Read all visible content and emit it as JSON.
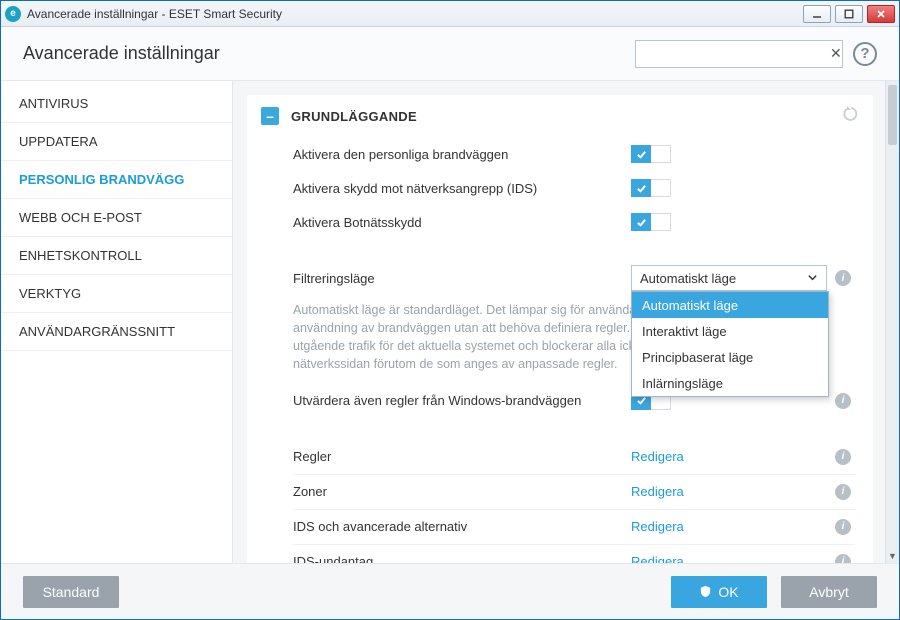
{
  "titlebar": {
    "app_icon_letter": "e",
    "title": "Avancerade inställningar - ESET Smart Security"
  },
  "header": {
    "title": "Avancerade inställningar",
    "search_placeholder": "",
    "search_value": "",
    "clear_glyph": "✕",
    "help_glyph": "?"
  },
  "sidebar": {
    "items": [
      {
        "label": "ANTIVIRUS",
        "active": false
      },
      {
        "label": "UPPDATERA",
        "active": false
      },
      {
        "label": "PERSONLIG BRANDVÄGG",
        "active": true
      },
      {
        "label": "WEBB OCH E-POST",
        "active": false
      },
      {
        "label": "ENHETSKONTROLL",
        "active": false
      },
      {
        "label": "VERKTYG",
        "active": false
      },
      {
        "label": "ANVÄNDARGRÄNSSNITT",
        "active": false
      }
    ]
  },
  "panel": {
    "collapse_glyph": "–",
    "title": "GRUNDLÄGGANDE",
    "toggles": [
      {
        "label": "Aktivera den personliga brandväggen",
        "on": true
      },
      {
        "label": "Aktivera skydd mot nätverksangrepp (IDS)",
        "on": true
      },
      {
        "label": "Aktivera Botnätsskydd",
        "on": true
      }
    ],
    "filtering": {
      "label": "Filtreringsläge",
      "selected": "Automatiskt läge",
      "options": [
        "Automatiskt läge",
        "Interaktivt läge",
        "Principbaserat läge",
        "Inlärningsläge"
      ],
      "description": "Automatiskt läge är standardläget. Det lämpar sig för användare som föredrar enkel och bekväm användning av brandväggen utan att behöva definiera regler. Automatiskt läge tillåter all utgående trafik för det aktuella systemet och blockerar alla icke-initierade anslutningar från nätverkssidan förutom de som anges av anpassade regler."
    },
    "eval_windows": {
      "label": "Utvärdera även regler från Windows-brandväggen",
      "on": true
    },
    "links": [
      {
        "label": "Regler",
        "action": "Redigera"
      },
      {
        "label": "Zoner",
        "action": "Redigera"
      },
      {
        "label": "IDS och avancerade alternativ",
        "action": "Redigera"
      },
      {
        "label": "IDS-undantag",
        "action": "Redigera"
      }
    ]
  },
  "footer": {
    "default": "Standard",
    "ok": "OK",
    "cancel": "Avbryt"
  }
}
